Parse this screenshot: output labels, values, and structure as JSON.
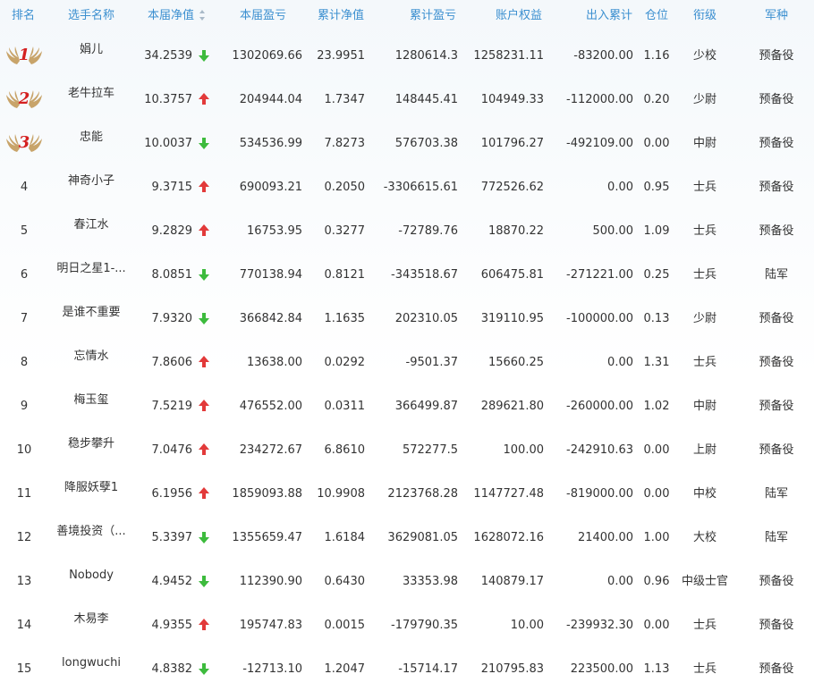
{
  "colors": {
    "header_text": "#3b8fd0",
    "up_arrow": "#e23a3a",
    "down_arrow": "#3dbb3d",
    "medal_number": "#d42020",
    "wing": "#c8a46a"
  },
  "headers": {
    "rank": "排名",
    "player": "选手名称",
    "nav": "本届净值",
    "profit": "本届盈亏",
    "cum_nav": "累计净值",
    "cum_profit": "累计盈亏",
    "equity": "账户权益",
    "cash_flow": "出入累计",
    "position": "仓位",
    "rank_title": "衔级",
    "branch": "军种"
  },
  "rows": [
    {
      "rank": "1",
      "medal": true,
      "name": "娟儿",
      "nav": "34.2539",
      "trend": "down",
      "profit": "1302069.66",
      "cum_nav": "23.9951",
      "cum_profit": "1280614.3",
      "equity": "1258231.11",
      "cash_flow": "-83200.00",
      "position": "1.16",
      "title": "少校",
      "branch": "预备役"
    },
    {
      "rank": "2",
      "medal": true,
      "name": "老牛拉车",
      "nav": "10.3757",
      "trend": "up",
      "profit": "204944.04",
      "cum_nav": "1.7347",
      "cum_profit": "148445.41",
      "equity": "104949.33",
      "cash_flow": "-112000.00",
      "position": "0.20",
      "title": "少尉",
      "branch": "预备役"
    },
    {
      "rank": "3",
      "medal": true,
      "name": "忠能",
      "nav": "10.0037",
      "trend": "down",
      "profit": "534536.99",
      "cum_nav": "7.8273",
      "cum_profit": "576703.38",
      "equity": "101796.27",
      "cash_flow": "-492109.00",
      "position": "0.00",
      "title": "中尉",
      "branch": "预备役"
    },
    {
      "rank": "4",
      "medal": false,
      "name": "神奇小子",
      "nav": "9.3715",
      "trend": "up",
      "profit": "690093.21",
      "cum_nav": "0.2050",
      "cum_profit": "-3306615.61",
      "equity": "772526.62",
      "cash_flow": "0.00",
      "position": "0.95",
      "title": "士兵",
      "branch": "预备役"
    },
    {
      "rank": "5",
      "medal": false,
      "name": "春江水",
      "nav": "9.2829",
      "trend": "up",
      "profit": "16753.95",
      "cum_nav": "0.3277",
      "cum_profit": "-72789.76",
      "equity": "18870.22",
      "cash_flow": "500.00",
      "position": "1.09",
      "title": "士兵",
      "branch": "预备役"
    },
    {
      "rank": "6",
      "medal": false,
      "name": "明日之星1-...",
      "nav": "8.0851",
      "trend": "down",
      "profit": "770138.94",
      "cum_nav": "0.8121",
      "cum_profit": "-343518.67",
      "equity": "606475.81",
      "cash_flow": "-271221.00",
      "position": "0.25",
      "title": "士兵",
      "branch": "陆军"
    },
    {
      "rank": "7",
      "medal": false,
      "name": "是谁不重要",
      "nav": "7.9320",
      "trend": "down",
      "profit": "366842.84",
      "cum_nav": "1.1635",
      "cum_profit": "202310.05",
      "equity": "319110.95",
      "cash_flow": "-100000.00",
      "position": "0.13",
      "title": "少尉",
      "branch": "预备役"
    },
    {
      "rank": "8",
      "medal": false,
      "name": "忘情水",
      "nav": "7.8606",
      "trend": "up",
      "profit": "13638.00",
      "cum_nav": "0.0292",
      "cum_profit": "-9501.37",
      "equity": "15660.25",
      "cash_flow": "0.00",
      "position": "1.31",
      "title": "士兵",
      "branch": "预备役"
    },
    {
      "rank": "9",
      "medal": false,
      "name": "梅玉玺",
      "nav": "7.5219",
      "trend": "up",
      "profit": "476552.00",
      "cum_nav": "0.0311",
      "cum_profit": "366499.87",
      "equity": "289621.80",
      "cash_flow": "-260000.00",
      "position": "1.02",
      "title": "中尉",
      "branch": "预备役"
    },
    {
      "rank": "10",
      "medal": false,
      "name": "稳步攀升",
      "nav": "7.0476",
      "trend": "up",
      "profit": "234272.67",
      "cum_nav": "6.8610",
      "cum_profit": "572277.5",
      "equity": "100.00",
      "cash_flow": "-242910.63",
      "position": "0.00",
      "title": "上尉",
      "branch": "预备役"
    },
    {
      "rank": "11",
      "medal": false,
      "name": "降服妖孽1",
      "nav": "6.1956",
      "trend": "up",
      "profit": "1859093.88",
      "cum_nav": "10.9908",
      "cum_profit": "2123768.28",
      "equity": "1147727.48",
      "cash_flow": "-819000.00",
      "position": "0.00",
      "title": "中校",
      "branch": "陆军"
    },
    {
      "rank": "12",
      "medal": false,
      "name": "善境投资（...",
      "nav": "5.3397",
      "trend": "down",
      "profit": "1355659.47",
      "cum_nav": "1.6184",
      "cum_profit": "3629081.05",
      "equity": "1628072.16",
      "cash_flow": "21400.00",
      "position": "1.00",
      "title": "大校",
      "branch": "陆军"
    },
    {
      "rank": "13",
      "medal": false,
      "name": "Nobody",
      "nav": "4.9452",
      "trend": "down",
      "profit": "112390.90",
      "cum_nav": "0.6430",
      "cum_profit": "33353.98",
      "equity": "140879.17",
      "cash_flow": "0.00",
      "position": "0.96",
      "title": "中级士官",
      "branch": "预备役"
    },
    {
      "rank": "14",
      "medal": false,
      "name": "木易李",
      "nav": "4.9355",
      "trend": "up",
      "profit": "195747.83",
      "cum_nav": "0.0015",
      "cum_profit": "-179790.35",
      "equity": "10.00",
      "cash_flow": "-239932.30",
      "position": "0.00",
      "title": "士兵",
      "branch": "预备役"
    },
    {
      "rank": "15",
      "medal": false,
      "name": "longwuchi",
      "nav": "4.8382",
      "trend": "down",
      "profit": "-12713.10",
      "cum_nav": "1.2047",
      "cum_profit": "-15714.17",
      "equity": "210795.83",
      "cash_flow": "223500.00",
      "position": "1.13",
      "title": "士兵",
      "branch": "预备役"
    }
  ]
}
